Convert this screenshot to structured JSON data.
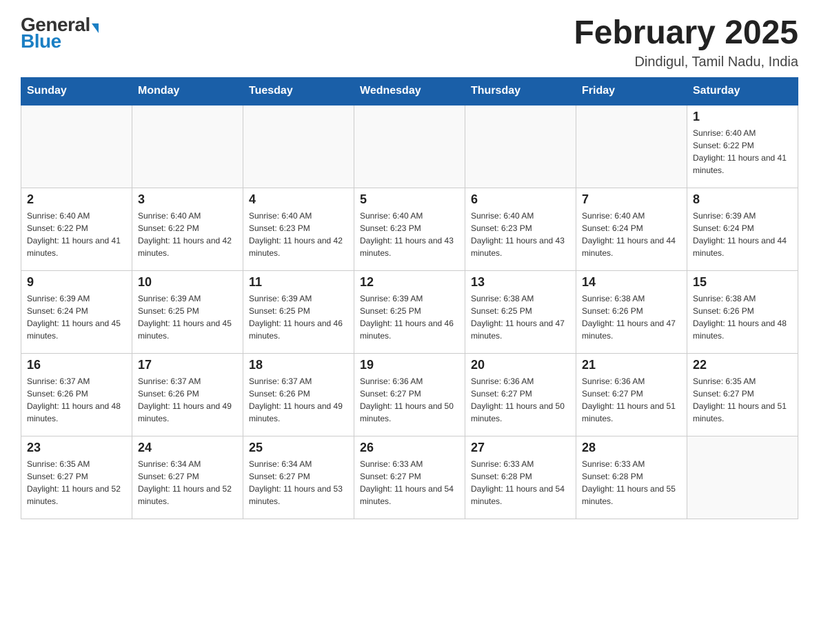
{
  "header": {
    "logo_general": "General",
    "logo_blue": "Blue",
    "month_title": "February 2025",
    "location": "Dindigul, Tamil Nadu, India"
  },
  "weekdays": [
    "Sunday",
    "Monday",
    "Tuesday",
    "Wednesday",
    "Thursday",
    "Friday",
    "Saturday"
  ],
  "weeks": [
    [
      {
        "day": "",
        "sunrise": "",
        "sunset": "",
        "daylight": ""
      },
      {
        "day": "",
        "sunrise": "",
        "sunset": "",
        "daylight": ""
      },
      {
        "day": "",
        "sunrise": "",
        "sunset": "",
        "daylight": ""
      },
      {
        "day": "",
        "sunrise": "",
        "sunset": "",
        "daylight": ""
      },
      {
        "day": "",
        "sunrise": "",
        "sunset": "",
        "daylight": ""
      },
      {
        "day": "",
        "sunrise": "",
        "sunset": "",
        "daylight": ""
      },
      {
        "day": "1",
        "sunrise": "Sunrise: 6:40 AM",
        "sunset": "Sunset: 6:22 PM",
        "daylight": "Daylight: 11 hours and 41 minutes."
      }
    ],
    [
      {
        "day": "2",
        "sunrise": "Sunrise: 6:40 AM",
        "sunset": "Sunset: 6:22 PM",
        "daylight": "Daylight: 11 hours and 41 minutes."
      },
      {
        "day": "3",
        "sunrise": "Sunrise: 6:40 AM",
        "sunset": "Sunset: 6:22 PM",
        "daylight": "Daylight: 11 hours and 42 minutes."
      },
      {
        "day": "4",
        "sunrise": "Sunrise: 6:40 AM",
        "sunset": "Sunset: 6:23 PM",
        "daylight": "Daylight: 11 hours and 42 minutes."
      },
      {
        "day": "5",
        "sunrise": "Sunrise: 6:40 AM",
        "sunset": "Sunset: 6:23 PM",
        "daylight": "Daylight: 11 hours and 43 minutes."
      },
      {
        "day": "6",
        "sunrise": "Sunrise: 6:40 AM",
        "sunset": "Sunset: 6:23 PM",
        "daylight": "Daylight: 11 hours and 43 minutes."
      },
      {
        "day": "7",
        "sunrise": "Sunrise: 6:40 AM",
        "sunset": "Sunset: 6:24 PM",
        "daylight": "Daylight: 11 hours and 44 minutes."
      },
      {
        "day": "8",
        "sunrise": "Sunrise: 6:39 AM",
        "sunset": "Sunset: 6:24 PM",
        "daylight": "Daylight: 11 hours and 44 minutes."
      }
    ],
    [
      {
        "day": "9",
        "sunrise": "Sunrise: 6:39 AM",
        "sunset": "Sunset: 6:24 PM",
        "daylight": "Daylight: 11 hours and 45 minutes."
      },
      {
        "day": "10",
        "sunrise": "Sunrise: 6:39 AM",
        "sunset": "Sunset: 6:25 PM",
        "daylight": "Daylight: 11 hours and 45 minutes."
      },
      {
        "day": "11",
        "sunrise": "Sunrise: 6:39 AM",
        "sunset": "Sunset: 6:25 PM",
        "daylight": "Daylight: 11 hours and 46 minutes."
      },
      {
        "day": "12",
        "sunrise": "Sunrise: 6:39 AM",
        "sunset": "Sunset: 6:25 PM",
        "daylight": "Daylight: 11 hours and 46 minutes."
      },
      {
        "day": "13",
        "sunrise": "Sunrise: 6:38 AM",
        "sunset": "Sunset: 6:25 PM",
        "daylight": "Daylight: 11 hours and 47 minutes."
      },
      {
        "day": "14",
        "sunrise": "Sunrise: 6:38 AM",
        "sunset": "Sunset: 6:26 PM",
        "daylight": "Daylight: 11 hours and 47 minutes."
      },
      {
        "day": "15",
        "sunrise": "Sunrise: 6:38 AM",
        "sunset": "Sunset: 6:26 PM",
        "daylight": "Daylight: 11 hours and 48 minutes."
      }
    ],
    [
      {
        "day": "16",
        "sunrise": "Sunrise: 6:37 AM",
        "sunset": "Sunset: 6:26 PM",
        "daylight": "Daylight: 11 hours and 48 minutes."
      },
      {
        "day": "17",
        "sunrise": "Sunrise: 6:37 AM",
        "sunset": "Sunset: 6:26 PM",
        "daylight": "Daylight: 11 hours and 49 minutes."
      },
      {
        "day": "18",
        "sunrise": "Sunrise: 6:37 AM",
        "sunset": "Sunset: 6:26 PM",
        "daylight": "Daylight: 11 hours and 49 minutes."
      },
      {
        "day": "19",
        "sunrise": "Sunrise: 6:36 AM",
        "sunset": "Sunset: 6:27 PM",
        "daylight": "Daylight: 11 hours and 50 minutes."
      },
      {
        "day": "20",
        "sunrise": "Sunrise: 6:36 AM",
        "sunset": "Sunset: 6:27 PM",
        "daylight": "Daylight: 11 hours and 50 minutes."
      },
      {
        "day": "21",
        "sunrise": "Sunrise: 6:36 AM",
        "sunset": "Sunset: 6:27 PM",
        "daylight": "Daylight: 11 hours and 51 minutes."
      },
      {
        "day": "22",
        "sunrise": "Sunrise: 6:35 AM",
        "sunset": "Sunset: 6:27 PM",
        "daylight": "Daylight: 11 hours and 51 minutes."
      }
    ],
    [
      {
        "day": "23",
        "sunrise": "Sunrise: 6:35 AM",
        "sunset": "Sunset: 6:27 PM",
        "daylight": "Daylight: 11 hours and 52 minutes."
      },
      {
        "day": "24",
        "sunrise": "Sunrise: 6:34 AM",
        "sunset": "Sunset: 6:27 PM",
        "daylight": "Daylight: 11 hours and 52 minutes."
      },
      {
        "day": "25",
        "sunrise": "Sunrise: 6:34 AM",
        "sunset": "Sunset: 6:27 PM",
        "daylight": "Daylight: 11 hours and 53 minutes."
      },
      {
        "day": "26",
        "sunrise": "Sunrise: 6:33 AM",
        "sunset": "Sunset: 6:27 PM",
        "daylight": "Daylight: 11 hours and 54 minutes."
      },
      {
        "day": "27",
        "sunrise": "Sunrise: 6:33 AM",
        "sunset": "Sunset: 6:28 PM",
        "daylight": "Daylight: 11 hours and 54 minutes."
      },
      {
        "day": "28",
        "sunrise": "Sunrise: 6:33 AM",
        "sunset": "Sunset: 6:28 PM",
        "daylight": "Daylight: 11 hours and 55 minutes."
      },
      {
        "day": "",
        "sunrise": "",
        "sunset": "",
        "daylight": ""
      }
    ]
  ]
}
